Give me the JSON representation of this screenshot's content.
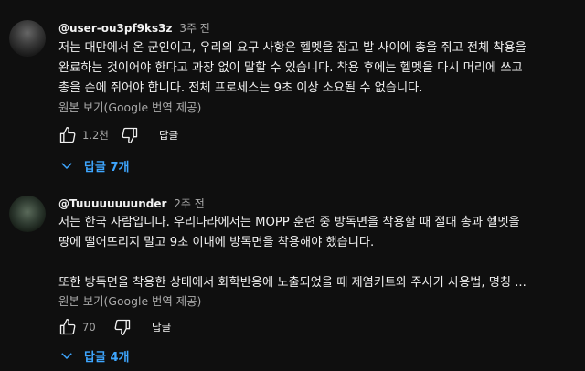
{
  "comments": [
    {
      "author": "@user-ou3pf9ks3z",
      "time": "3주 전",
      "lines": [
        "저는 대만에서 온 군인이고, 우리의 요구 사항은 헬멧을 잡고 발 사이에 총을 쥐고 전체 착용을",
        "완료하는 것이어야 한다고 과장 없이 말할 수 있습니다. 착용 후에는 헬멧을 다시 머리에 쓰고",
        "총을 손에 쥐어야 합니다. 전체 프로세스는 9초 이상 소요될 수 없습니다."
      ],
      "translate_label": "원본 보기(Google 번역 제공)",
      "likes": "1.2천",
      "reply_label": "답글",
      "replies_label": "답글 7개"
    },
    {
      "author": "@Tuuuuuuuunder",
      "time": "2주 전",
      "lines": [
        "저는 한국 사람입니다. 우리나라에서는 MOPP 훈련 중 방독면을 착용할 때 절대 총과 헬멧을",
        "땅에 떨어뜨리지 말고 9초 이내에 방독면을 착용해야 했습니다.",
        "",
        "또한 방독면을 착용한 상태에서 화학반응에 노출되었을 때 제염키트와 주사기 사용법, 명칭 ..."
      ],
      "translate_label": "원본 보기(Google 번역 제공)",
      "likes": "70",
      "reply_label": "답글",
      "replies_label": "답글 4개"
    }
  ],
  "icons": {
    "like": "thumb-up-icon",
    "dislike": "thumb-down-icon",
    "expand": "chevron-down-icon"
  },
  "colors": {
    "background": "#0f0f0f",
    "text": "#f1f1f1",
    "secondary": "#aaaaaa",
    "link": "#3ea6ff"
  }
}
